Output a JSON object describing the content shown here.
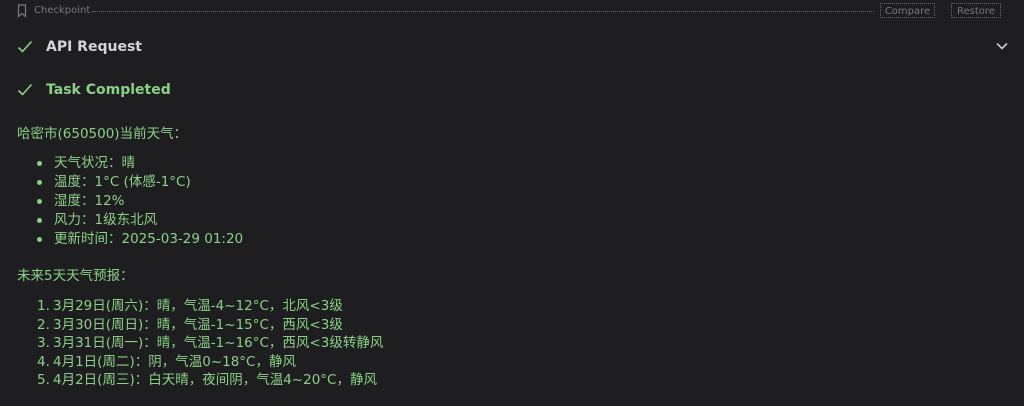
{
  "checkpoint": {
    "label": "Checkpoint",
    "compare_label": "Compare",
    "restore_label": "Restore"
  },
  "api_request": {
    "title": "API Request"
  },
  "task": {
    "title": "Task Completed",
    "current_heading": "哈密市(650500)当前天气：",
    "current_items": [
      "天气状况：晴",
      "温度：1°C (体感-1°C)",
      "湿度：12%",
      "风力：1级东北风",
      "更新时间：2025-03-29 01:20"
    ],
    "forecast_heading": "未来5天天气预报：",
    "forecast_items": [
      {
        "num": "1.",
        "text": "3月29日(周六)：晴，气温-4~12°C，北风<3级"
      },
      {
        "num": "2.",
        "text": "3月30日(周日)：晴，气温-1~15°C，西风<3级"
      },
      {
        "num": "3.",
        "text": "3月31日(周一)：晴，气温-1~16°C，西风<3级转静风"
      },
      {
        "num": "4.",
        "text": "4月1日(周二)：阴，气温0~18°C，静风"
      },
      {
        "num": "5.",
        "text": "4月2日(周三)：白天晴，夜间阴，气温4~20°C，静风"
      }
    ]
  },
  "colors": {
    "background": "#1e1e20",
    "success_green": "#89d185",
    "muted": "#7a7a7a"
  },
  "icons": {
    "checkpoint": "bookmark-icon",
    "status": "check-icon",
    "expand": "chevron-down-icon"
  }
}
